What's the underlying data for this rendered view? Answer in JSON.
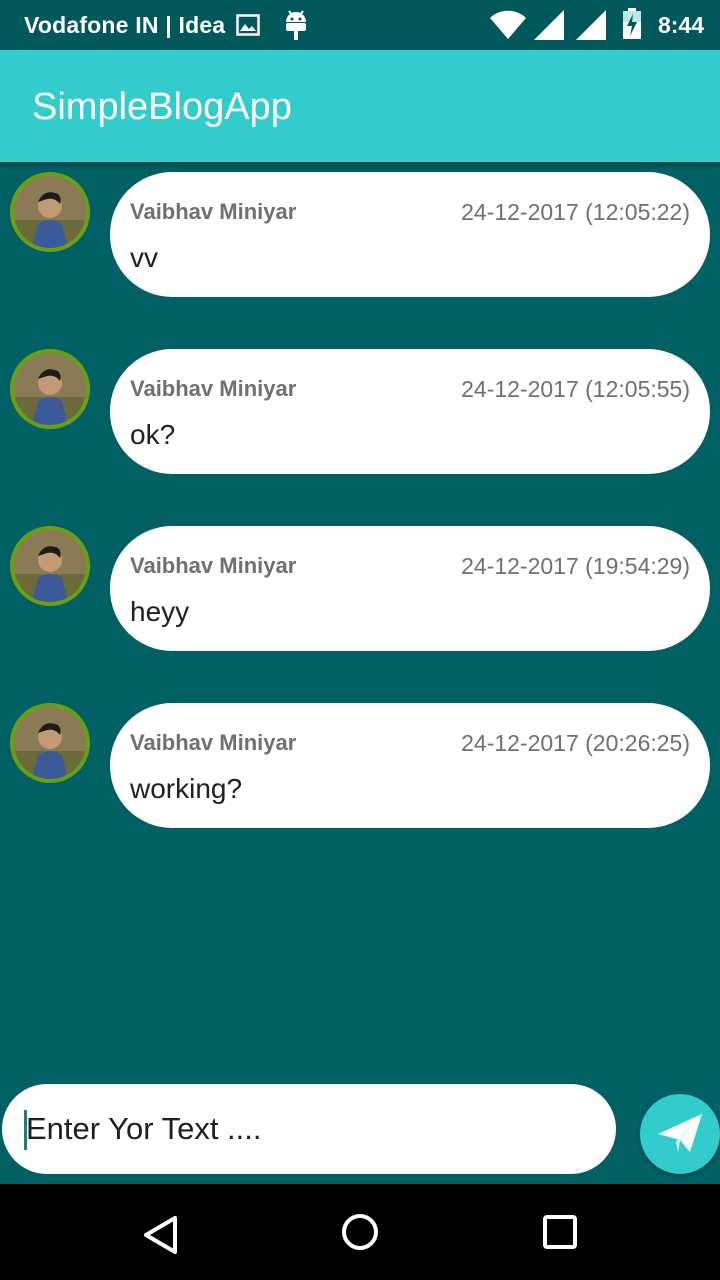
{
  "status_bar": {
    "carrier": "Vodafone IN | Idea",
    "time": "8:44",
    "icons": [
      "image-icon",
      "android-icon",
      "wifi-icon",
      "signal-icon",
      "signal-icon",
      "battery-icon"
    ]
  },
  "app_bar": {
    "title": "SimpleBlogApp",
    "color": "#33cccc"
  },
  "messages": [
    {
      "author": "Vaibhav Miniyar",
      "timestamp": "24-12-2017 (12:05:22)",
      "text": "vv"
    },
    {
      "author": "Vaibhav Miniyar",
      "timestamp": "24-12-2017 (12:05:55)",
      "text": "ok?"
    },
    {
      "author": "Vaibhav Miniyar",
      "timestamp": "24-12-2017 (19:54:29)",
      "text": "heyy"
    },
    {
      "author": "Vaibhav Miniyar",
      "timestamp": "24-12-2017 (20:26:25)",
      "text": "working?"
    }
  ],
  "composer": {
    "placeholder": "Enter Yor Text ....",
    "send_icon": "send-paper-plane-icon"
  },
  "nav_bar": {
    "icons": [
      "back-icon",
      "home-icon",
      "recents-icon"
    ]
  },
  "colors": {
    "background": "#006064",
    "accent": "#33cccc",
    "avatar_ring": "#6a9f12"
  }
}
